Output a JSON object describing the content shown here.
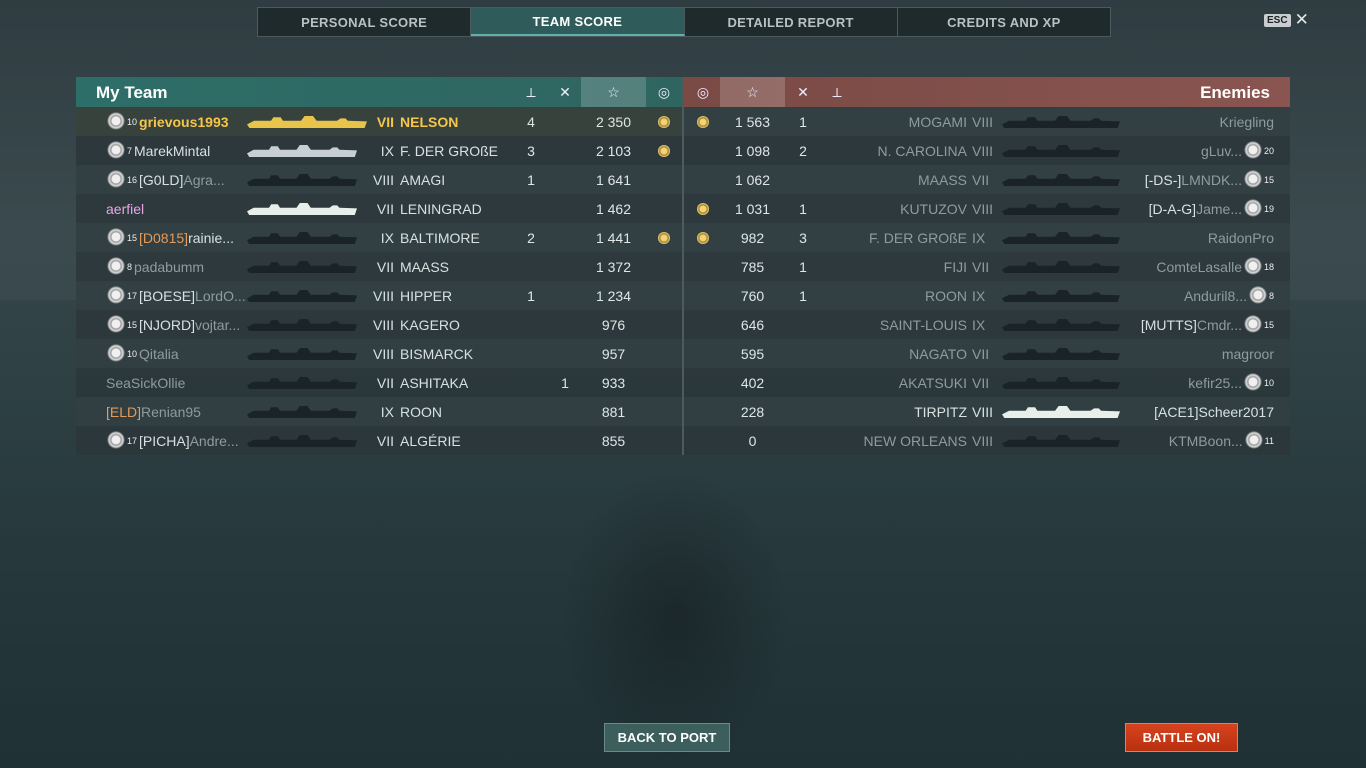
{
  "tabs": [
    {
      "label": "PERSONAL SCORE",
      "active": false
    },
    {
      "label": "TEAM SCORE",
      "active": true
    },
    {
      "label": "DETAILED REPORT",
      "active": false
    },
    {
      "label": "CREDITS AND XP",
      "active": false
    }
  ],
  "esc_label": "ESC",
  "my_team": {
    "title": "My Team",
    "header_icons": [
      "ship-hit-icon",
      "planes-destroyed-icon",
      "star-icon",
      "medal-icon"
    ],
    "rows": [
      {
        "rank": "10",
        "clan": "",
        "player": "grievous1993",
        "tier": "VII",
        "ship": "NELSON",
        "kills": "4",
        "planes": "",
        "score": "2 350",
        "medal": true,
        "highlight": true,
        "ship_color": "gold"
      },
      {
        "rank": "7",
        "clan": "",
        "player": "MarekMintal",
        "tier": "IX",
        "ship": "F. DER GROßE",
        "kills": "3",
        "planes": "",
        "score": "2 103",
        "medal": true,
        "ship_color": "silver"
      },
      {
        "rank": "16",
        "clan": "[G0LD]",
        "player": "Agra...",
        "tier": "VIII",
        "ship": "AMAGI",
        "kills": "1",
        "planes": "",
        "score": "1 641",
        "medal": false,
        "dim": true
      },
      {
        "rank": "",
        "clan": "",
        "player": "aerfiel",
        "tier": "VII",
        "ship": "LENINGRAD",
        "kills": "",
        "planes": "",
        "score": "1 462",
        "medal": false,
        "pink": true,
        "ship_color": "white"
      },
      {
        "rank": "15",
        "clan": "[D0815]",
        "player": "rainie...",
        "tier": "IX",
        "ship": "BALTIMORE",
        "kills": "2",
        "planes": "",
        "score": "1 441",
        "medal": true,
        "orange_clan": true
      },
      {
        "rank": "8",
        "clan": "",
        "player": "padabumm",
        "tier": "VII",
        "ship": "MAASS",
        "kills": "",
        "planes": "",
        "score": "1 372",
        "medal": false,
        "dim": true
      },
      {
        "rank": "17",
        "clan": "[BOESE]",
        "player": "LordO...",
        "tier": "VIII",
        "ship": "HIPPER",
        "kills": "1",
        "planes": "",
        "score": "1 234",
        "medal": false,
        "dim": true
      },
      {
        "rank": "15",
        "clan": "[NJORD]",
        "player": "vojtar...",
        "tier": "VIII",
        "ship": "KAGERO",
        "kills": "",
        "planes": "",
        "score": "976",
        "medal": false,
        "dim": true
      },
      {
        "rank": "10",
        "clan": "",
        "player": "Qitalia",
        "tier": "VIII",
        "ship": "BISMARCK",
        "kills": "",
        "planes": "",
        "score": "957",
        "medal": false,
        "dim": true
      },
      {
        "rank": "",
        "clan": "",
        "player": "SeaSickOllie",
        "tier": "VII",
        "ship": "ASHITAKA",
        "kills": "",
        "planes": "1",
        "score": "933",
        "medal": false,
        "dim": true
      },
      {
        "rank": "",
        "clan": "[ELD]",
        "player": "Renian95",
        "tier": "IX",
        "ship": "ROON",
        "kills": "",
        "planes": "",
        "score": "881",
        "medal": false,
        "dim": true,
        "orange_clan": true
      },
      {
        "rank": "17",
        "clan": "[PICHA]",
        "player": "Andre...",
        "tier": "VII",
        "ship": "ALGÉRIE",
        "kills": "",
        "planes": "",
        "score": "855",
        "medal": false,
        "dim": true
      }
    ]
  },
  "enemies": {
    "title": "Enemies",
    "header_icons": [
      "medal-icon",
      "star-icon",
      "planes-destroyed-icon",
      "ship-hit-icon"
    ],
    "rows": [
      {
        "medal": true,
        "score": "1 563",
        "kills": "1",
        "ship": "MOGAMI",
        "tier": "VIII",
        "clan": "",
        "player": "Kriegling",
        "rank": ""
      },
      {
        "medal": false,
        "score": "1 098",
        "kills": "2",
        "ship": "N. CAROLINA",
        "tier": "VIII",
        "clan": "",
        "player": "gLuv...",
        "rank": "20"
      },
      {
        "medal": false,
        "score": "1 062",
        "kills": "",
        "ship": "MAASS",
        "tier": "VII",
        "clan": "[-DS-]",
        "player": "LMNDK...",
        "rank": "15"
      },
      {
        "medal": true,
        "score": "1 031",
        "kills": "1",
        "ship": "KUTUZOV",
        "tier": "VIII",
        "clan": "[D-A-G]",
        "player": "Jame...",
        "rank": "19"
      },
      {
        "medal": true,
        "score": "982",
        "kills": "3",
        "ship": "F. DER GROßE",
        "tier": "IX",
        "clan": "",
        "player": "RaidonPro",
        "rank": ""
      },
      {
        "medal": false,
        "score": "785",
        "kills": "1",
        "ship": "FIJI",
        "tier": "VII",
        "clan": "",
        "player": "ComteLasalle",
        "rank": "18"
      },
      {
        "medal": false,
        "score": "760",
        "kills": "1",
        "ship": "ROON",
        "tier": "IX",
        "clan": "",
        "player": "Anduril8...",
        "rank": "8"
      },
      {
        "medal": false,
        "score": "646",
        "kills": "",
        "ship": "SAINT-LOUIS",
        "tier": "IX",
        "clan": "[MUTTS]",
        "player": "Cmdr...",
        "rank": "15"
      },
      {
        "medal": false,
        "score": "595",
        "kills": "",
        "ship": "NAGATO",
        "tier": "VII",
        "clan": "",
        "player": "magroor",
        "rank": ""
      },
      {
        "medal": false,
        "score": "402",
        "kills": "",
        "ship": "AKATSUKI",
        "tier": "VII",
        "clan": "",
        "player": "kefir25...",
        "rank": "10"
      },
      {
        "medal": false,
        "score": "228",
        "kills": "",
        "ship": "TIRPITZ",
        "tier": "VIII",
        "clan": "[ACE1]",
        "player": "Scheer2017",
        "rank": "",
        "bright": true
      },
      {
        "medal": false,
        "score": "0",
        "kills": "",
        "ship": "NEW ORLEANS",
        "tier": "VIII",
        "clan": "",
        "player": "KTMBoon...",
        "rank": "11"
      }
    ]
  },
  "buttons": {
    "back_to_port": "BACK TO PORT",
    "battle_on": "BATTLE ON!"
  }
}
